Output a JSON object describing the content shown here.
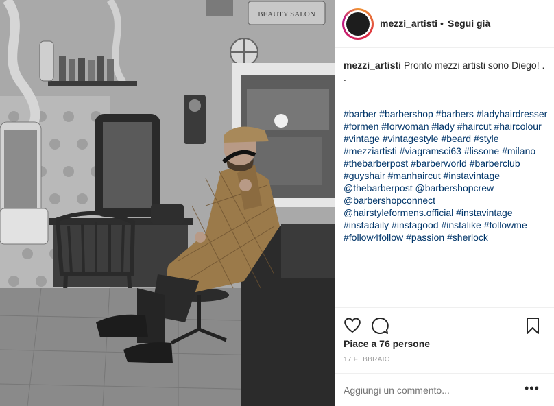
{
  "post": {
    "username": "mezzi_artisti",
    "separator": "•",
    "follow_label": "Segui già",
    "caption_text": "Pronto mezzi artisti sono Diego! .",
    "caption_dot": ".",
    "hashtags": [
      "#barber",
      "#barbershop",
      "#barbers",
      "#ladyhairdresser",
      "#formen",
      "#forwoman",
      "#lady",
      "#haircut",
      "#haircolour",
      "#vintage",
      "#vintagestyle",
      "#beard",
      "#style",
      "#mezziartisti",
      "#viagramsci63",
      "#lissone",
      "#milano",
      "#thebarberpost",
      "#barberworld",
      "#barberclub",
      "#guyshair",
      "#manhaircut",
      "#instavintage",
      "@thebarberpost",
      "@barbershopcrew",
      "@barbershopconnect",
      "@hairstyleformens.official",
      "#instavintage",
      "#instadaily",
      "#instagood",
      "#instalike",
      "#followme",
      "#follow4follow",
      "#passion",
      "#sherlock"
    ],
    "likes_label": "Piace a 76 persone",
    "date_label": "17 FEBBRAIO",
    "comment_placeholder": "Aggiungi un commento...",
    "more_label": "•••",
    "photo_sign_text": "BEAUTY SALON"
  },
  "icons": {
    "like": "heart-icon",
    "comment": "comment-icon",
    "save": "bookmark-icon"
  },
  "colors": {
    "link": "#003569",
    "text": "#262626",
    "muted": "#999999",
    "border": "#efefef"
  }
}
